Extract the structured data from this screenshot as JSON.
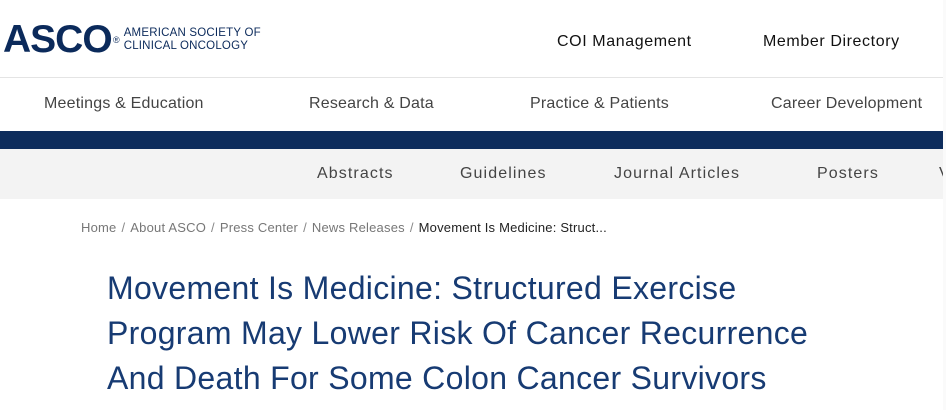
{
  "logo": {
    "mark": "ASCO",
    "registered": "®",
    "line1": "AMERICAN SOCIETY OF",
    "line2": "CLINICAL ONCOLOGY"
  },
  "top_links": {
    "coi": "COI Management",
    "member": "Member Directory"
  },
  "main_nav": [
    "Meetings & Education",
    "Research & Data",
    "Practice & Patients",
    "Career Development"
  ],
  "sub_nav": [
    "Abstracts",
    "Guidelines",
    "Journal Articles",
    "Posters",
    "V"
  ],
  "breadcrumb": {
    "items": [
      "Home",
      "About ASCO",
      "Press Center",
      "News Releases"
    ],
    "separator": "/",
    "current": "Movement Is Medicine: Struct..."
  },
  "headline": {
    "lines": [
      "Movement Is Medicine: Structured Exercise",
      "Program May Lower Risk Of Cancer Recurrence",
      "And Death For Some Colon Cancer Survivors"
    ]
  },
  "colors": {
    "brand_navy": "#0d2c5c",
    "headline": "#173b73",
    "subnav_bg": "#f3f3f3"
  }
}
